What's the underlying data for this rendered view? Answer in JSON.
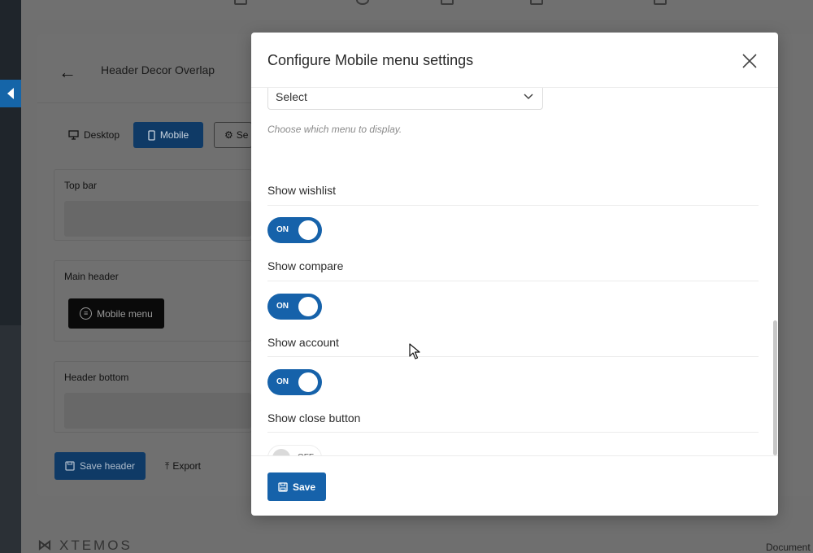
{
  "background": {
    "page_title": "Header Decor Overlap",
    "view_tabs": {
      "desktop": "Desktop",
      "mobile": "Mobile",
      "settings": "Se"
    },
    "sections": {
      "top_bar": "Top bar",
      "main_header": "Main header",
      "header_bottom": "Header bottom"
    },
    "element_button": "Mobile menu",
    "save_header_button": "Save header",
    "export_button": "Export",
    "footer_logo": "XTEMOS",
    "footer_link": "Document"
  },
  "modal": {
    "title": "Configure Mobile menu settings",
    "menu_select": {
      "value": "Select",
      "help": "Choose which menu to display."
    },
    "options": [
      {
        "label": "Show wishlist",
        "state": "ON"
      },
      {
        "label": "Show compare",
        "state": "ON"
      },
      {
        "label": "Show account",
        "state": "ON"
      },
      {
        "label": "Show close button",
        "state": "OFF"
      }
    ],
    "save_button": "Save"
  },
  "colors": {
    "primary": "#1662aa",
    "dark_primary": "#0f3a66",
    "overlay": "#6f6f6f"
  }
}
